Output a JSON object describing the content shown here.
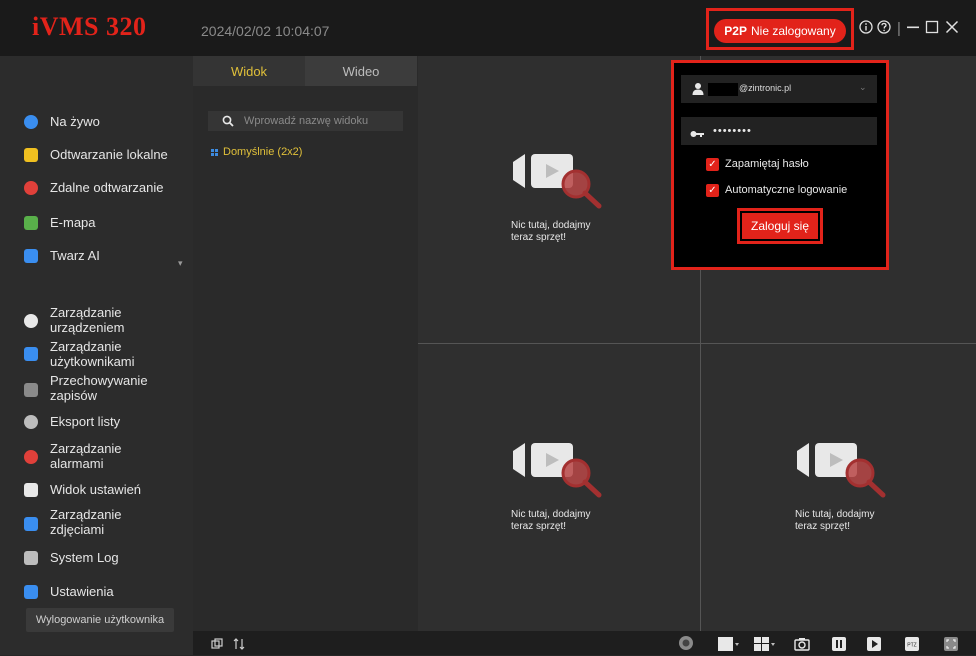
{
  "app": {
    "title": "iVMS 320",
    "datetime": "2024/02/02 10:04:07"
  },
  "titlebar": {
    "p2p_badge": "P2P",
    "p2p_status": "Nie zalogowany",
    "icons": [
      "info-icon",
      "help-icon",
      "minimize-icon",
      "maximize-icon",
      "close-icon"
    ]
  },
  "sidebar": {
    "items": [
      {
        "label": "Na żywo",
        "icon": "live-view-icon",
        "color": "#3a8ef0"
      },
      {
        "label": "Odtwarzanie lokalne",
        "icon": "local-playback-icon",
        "color": "#f0c020"
      },
      {
        "label": "Zdalne odtwarzanie",
        "icon": "remote-playback-icon",
        "color": "#e0403a"
      },
      {
        "label": "E-mapa",
        "icon": "emap-icon",
        "color": "#59b04a"
      },
      {
        "label": "Twarz AI",
        "icon": "face-ai-icon",
        "color": "#3a8ef0"
      },
      {
        "label": "Zarządzanie urządzeniem",
        "icon": "device-manage-icon",
        "color": "#e8e8e8"
      },
      {
        "label": "Zarządzanie użytkownikami",
        "icon": "user-manage-icon",
        "color": "#3a8ef0"
      },
      {
        "label": "Przechowywanie zapisów",
        "icon": "storage-icon",
        "color": "#8a8a8a"
      },
      {
        "label": "Eksport listy",
        "icon": "export-list-icon",
        "color": "#bdbdbd"
      },
      {
        "label": "Zarządzanie alarmami",
        "icon": "alarm-icon",
        "color": "#e0403a"
      },
      {
        "label": "Widok ustawień",
        "icon": "view-settings-icon",
        "color": "#e8e8e8"
      },
      {
        "label": "Zarządzanie zdjęciami",
        "icon": "photo-manage-icon",
        "color": "#3a8ef0"
      },
      {
        "label": "System Log",
        "icon": "system-log-icon",
        "color": "#bdbdbd"
      },
      {
        "label": "Ustawienia",
        "icon": "settings-icon",
        "color": "#3a8ef0"
      }
    ],
    "logout": "Wylogowanie użytkownika"
  },
  "view_panel": {
    "tabs": [
      "Widok",
      "Wideo"
    ],
    "search_placeholder": "Wprowadź nazwę widoku",
    "default_view": "Domyślnie (2x2)"
  },
  "grid": {
    "empty_line1": "Nic tutaj, dodajmy",
    "empty_line2": "teraz sprzęt!"
  },
  "login": {
    "username_suffix": "@zintronic.pl",
    "password_masked": "••••••••",
    "remember_password": "Zapamiętaj hasło",
    "auto_login": "Automatyczne logowanie",
    "login_button": "Zaloguj się"
  },
  "colors": {
    "accent": "#e2231a",
    "highlight_text": "#e0c03a"
  }
}
